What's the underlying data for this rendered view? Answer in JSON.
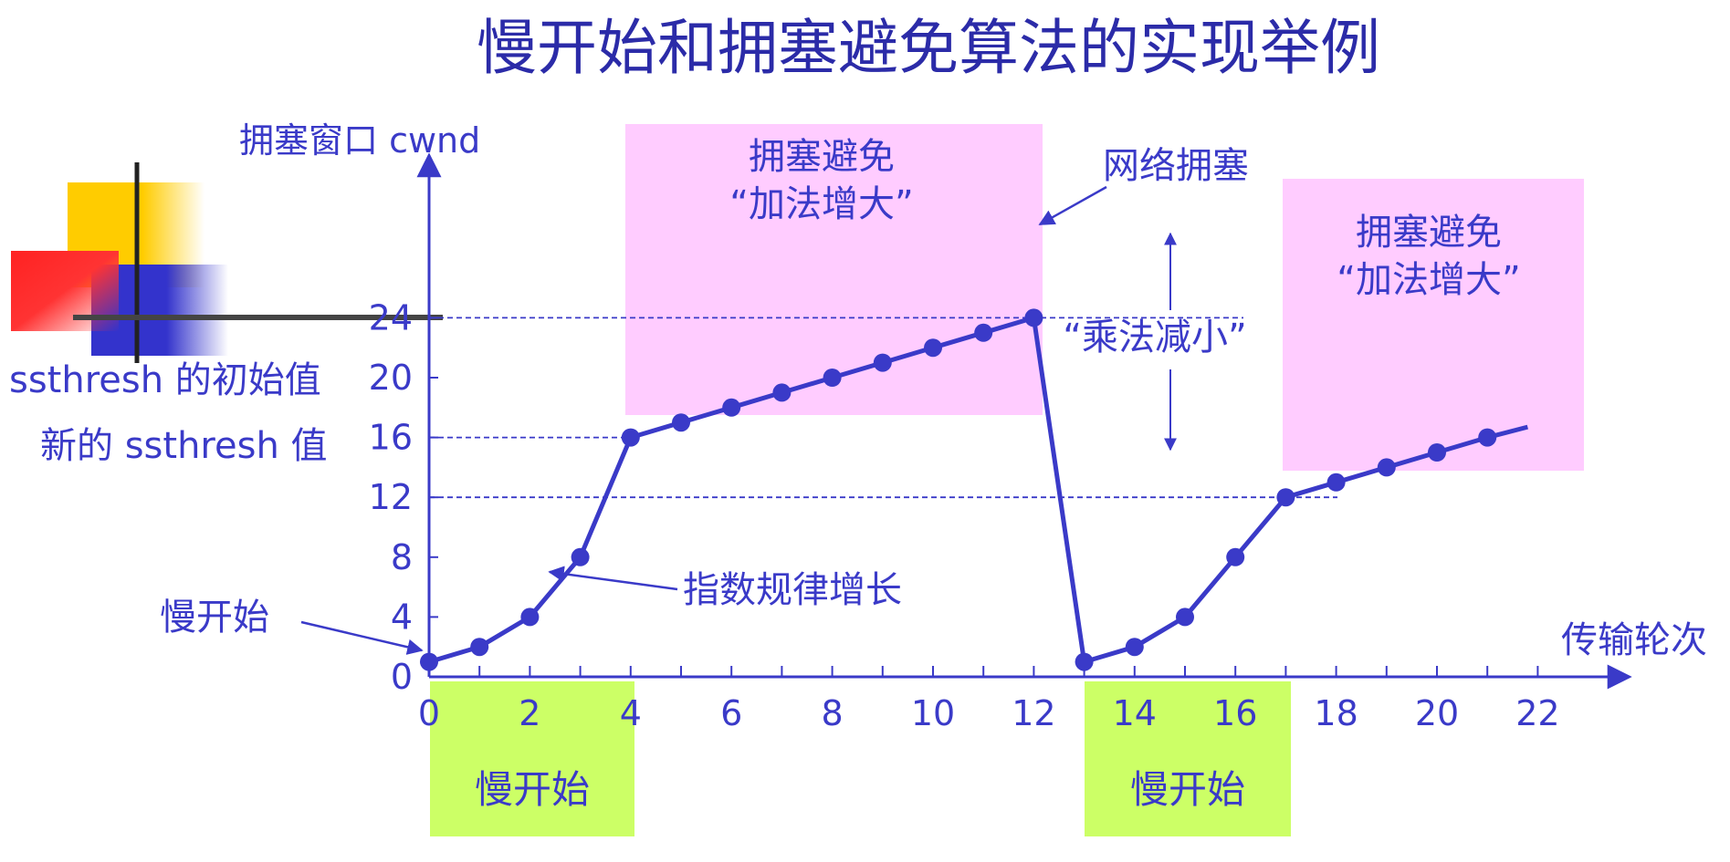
{
  "title": "慢开始和拥塞避免算法的实现举例",
  "colors": {
    "accent": "#3a3ac8",
    "title": "#2b2ba8",
    "pink": "#ffccff",
    "green": "#ccff66",
    "deco_yellow": "#ffcc00",
    "deco_red": "#ff2a2a",
    "deco_blue": "#3333cc"
  },
  "chart_data": {
    "type": "line",
    "title": "",
    "ylabel": "拥塞窗口 cwnd",
    "xlabel": "传输轮次",
    "xlim": [
      0,
      23
    ],
    "ylim": [
      0,
      26
    ],
    "xticks": [
      "0",
      "2",
      "4",
      "6",
      "8",
      "10",
      "12",
      "14",
      "16",
      "18",
      "20",
      "22"
    ],
    "xtick_values": [
      0,
      2,
      4,
      6,
      8,
      10,
      12,
      14,
      16,
      18,
      20,
      22
    ],
    "yticks": [
      "0",
      "4",
      "8",
      "12",
      "16",
      "20",
      "24"
    ],
    "ytick_values": [
      0,
      4,
      8,
      12,
      16,
      20,
      24
    ],
    "series": [
      {
        "x": [
          0,
          1,
          2,
          3,
          4,
          5,
          6,
          7,
          8,
          9,
          10,
          11,
          12,
          13,
          14,
          15,
          16,
          17,
          18,
          19,
          20,
          21
        ],
        "y": [
          1,
          2,
          4,
          8,
          16,
          17,
          18,
          19,
          20,
          21,
          22,
          23,
          24,
          1,
          2,
          4,
          8,
          12,
          13,
          14,
          15,
          16
        ]
      }
    ],
    "line_tail_to": [
      21.8,
      16.7
    ],
    "thresholds": [
      {
        "y": 24,
        "label": ""
      },
      {
        "y": 16,
        "label": "ssthresh 的初始值"
      },
      {
        "y": 12,
        "label": "新的 ssthresh 值"
      }
    ],
    "regions": [
      {
        "kind": "pink",
        "line1": "拥塞避免",
        "line2": "“加法增大”"
      },
      {
        "kind": "pink",
        "line1": "拥塞避免",
        "line2": "“加法增大”"
      },
      {
        "kind": "green",
        "line1": "慢开始"
      },
      {
        "kind": "green",
        "line1": "慢开始"
      }
    ],
    "annotations": {
      "slow_start": "慢开始",
      "exponential": "指数规律增长",
      "congestion": "网络拥塞",
      "multiplicative": "“乘法减小”"
    }
  }
}
